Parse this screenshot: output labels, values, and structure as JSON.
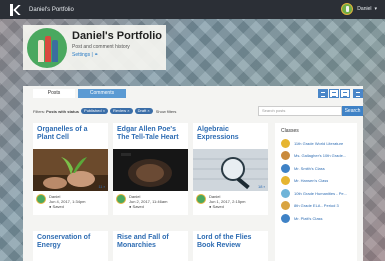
{
  "topbar": {
    "title": "Daniel's Portfolio",
    "user_name": "Daniel",
    "chevron": "▾"
  },
  "profile": {
    "name": "Daniel's Portfolio",
    "subtitle": "Post and comment history",
    "links": "Settings | ⚭"
  },
  "tabs": {
    "posts": "Posts",
    "comments": "Comments"
  },
  "filters": {
    "label": "Filters:",
    "bold_label": "Posts with status",
    "pills": [
      "Published ×",
      "Review ×",
      "Draft ×"
    ],
    "show": "Show filters"
  },
  "search": {
    "placeholder": "Search posts",
    "button": "Search"
  },
  "cards": [
    {
      "title": "Organelles of a Plant Cell",
      "count": "11 ▪",
      "author": "Daniel",
      "date": "Jun 4, 2017, 1:34pm",
      "status": "● Saved"
    },
    {
      "title": "Edgar Allen Poe's The Tell-Tale Heart",
      "count": "",
      "author": "Daniel",
      "date": "Jun 2, 2017, 11:46am",
      "status": "● Saved"
    },
    {
      "title": "Algebraic Expressions",
      "count": "18 ▪",
      "author": "Daniel",
      "date": "Jun 1, 2017, 2:15pm",
      "status": "● Saved"
    },
    {
      "title": "Conservation of Energy"
    },
    {
      "title": "Rise and Fall of Monarchies"
    },
    {
      "title": "Lord of the Flies Book Review"
    }
  ],
  "classes": {
    "heading": "Classes",
    "items": [
      {
        "label": "11th Grade World Literature",
        "color": "#e6b530"
      },
      {
        "label": "Ms. Gallagher's 10th Grade...",
        "color": "#c98a3c"
      },
      {
        "label": "Mr. Smith's Class",
        "color": "#3f82c6"
      },
      {
        "label": "Mr. Hansen's Class",
        "color": "#e6b530"
      },
      {
        "label": "10th Grade Humanities - Pe...",
        "color": "#6fb4d8"
      },
      {
        "label": "8th Grade ELA - Period 3",
        "color": "#d9a441"
      },
      {
        "label": "Mr. Platt's Class",
        "color": "#3f82c6"
      }
    ]
  }
}
